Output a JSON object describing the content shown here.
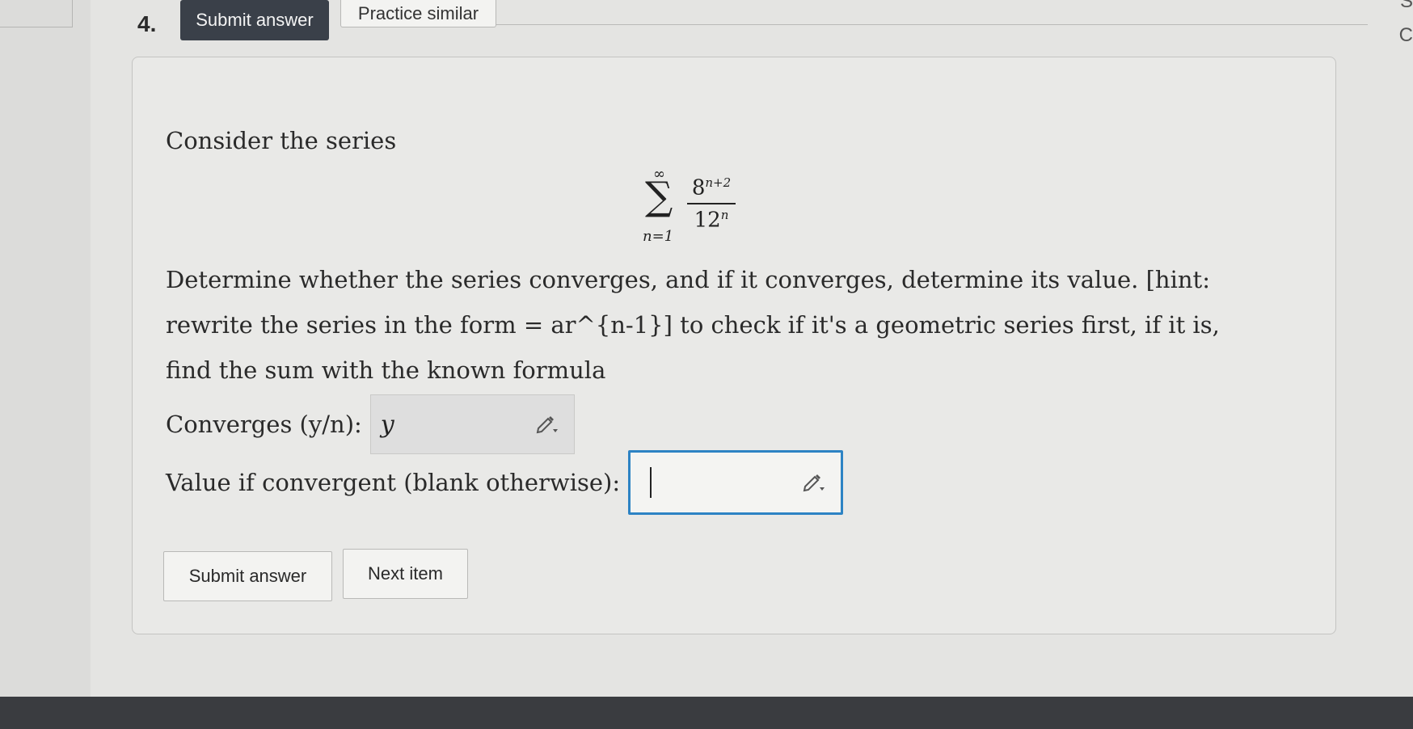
{
  "question": {
    "number": "4.",
    "submit_top_label": "Submit answer",
    "practice_label": "Practice similar",
    "intro": "Consider the series",
    "series": {
      "upper": "∞",
      "sigma": "∑",
      "lower": "n=1",
      "numerator_base": "8",
      "numerator_exp": "n+2",
      "denominator_base": "12",
      "denominator_exp": "n"
    },
    "prompt": "Determine whether the series converges, and if it converges, determine its value. [hint: rewrite the series in the form = ar^{n-1}] to check if it's a geometric series first, if it is, find the sum with the known formula",
    "converges_label": "Converges (y/n):",
    "converges_value": "y",
    "value_label": "Value if convergent (blank otherwise):",
    "value_value": "",
    "submit_label": "Submit answer",
    "next_label": "Next item"
  },
  "edge": {
    "top_right": "S",
    "right": "C"
  },
  "icons": {
    "pencil": "pencil-icon"
  },
  "colors": {
    "active_input_border": "#2d83c4",
    "primary_button": "#3a4049"
  }
}
